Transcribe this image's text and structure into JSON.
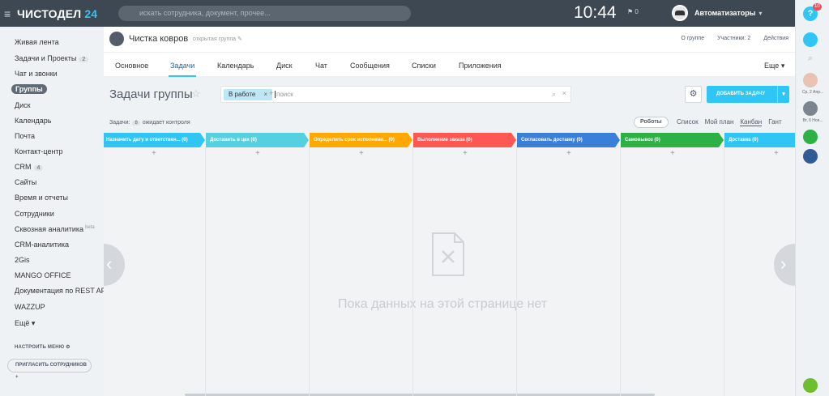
{
  "header": {
    "logo": "ЧИСТОДЕЛ",
    "logo_num": "24",
    "search_placeholder": "искать сотрудника, документ, прочее...",
    "clock": "10:44",
    "flag_count": "0",
    "user_name": "Автоматизаторы"
  },
  "rightbar": {
    "help": "?",
    "badge": "10",
    "chat1_label": "Ср, 2 Апр...",
    "chat2_label": "Вт, 6 Ноя..."
  },
  "sidebar": {
    "items": [
      {
        "label": "Живая лента"
      },
      {
        "label": "Задачи и Проекты",
        "count": "2"
      },
      {
        "label": "Чат и звонки"
      },
      {
        "label": "Группы"
      },
      {
        "label": "Диск"
      },
      {
        "label": "Календарь"
      },
      {
        "label": "Почта"
      },
      {
        "label": "Контакт-центр"
      },
      {
        "label": "CRM",
        "count": "4"
      },
      {
        "label": "Сайты"
      },
      {
        "label": "Время и отчеты"
      },
      {
        "label": "Сотрудники"
      },
      {
        "label": "Сквозная аналитика",
        "sup": "beta"
      },
      {
        "label": "CRM-аналитика"
      },
      {
        "label": "2Gis"
      },
      {
        "label": "MANGO OFFICE"
      },
      {
        "label": "Документация по REST API"
      },
      {
        "label": "WAZZUP"
      },
      {
        "label": "Ещё"
      }
    ],
    "configure_label": "НАСТРОИТЬ МЕНЮ",
    "invite_label": "ПРИГЛАСИТЬ СОТРУДНИКОВ"
  },
  "group": {
    "title": "Чистка ковров",
    "type": "открытая группа",
    "links": [
      "О группе",
      "Участники: 2",
      "Действия"
    ]
  },
  "tabs": [
    "Основное",
    "Задачи",
    "Календарь",
    "Диск",
    "Чат",
    "Сообщения",
    "Списки",
    "Приложения"
  ],
  "tabs_more": "Еще",
  "page": {
    "title": "Задачи группы",
    "filter_chip": "В работе",
    "filter_placeholder": "поиск",
    "add_button": "ДОБАВИТЬ ЗАДАЧУ"
  },
  "subbar": {
    "tasks_label": "Задачи:",
    "tasks_count": "8",
    "control_label": "ожидает контроля",
    "robots": "Роботы",
    "views": [
      "Список",
      "Мой план",
      "Канбан",
      "Гант"
    ]
  },
  "stages": [
    {
      "label": "Назначить дату и ответствен...",
      "count": "(0)",
      "color": "#2fc6f6"
    },
    {
      "label": "Доставить в цех",
      "count": "(0)",
      "color": "#55d0e0"
    },
    {
      "label": "Определить срок исполнени...",
      "count": "(0)",
      "color": "#ffa900"
    },
    {
      "label": "Выполнение заказа",
      "count": "(0)",
      "color": "#ff5752"
    },
    {
      "label": "Согласовать доставку",
      "count": "(0)",
      "color": "#3a80d9"
    },
    {
      "label": "Самовывоз",
      "count": "(0)",
      "color": "#2eb144"
    },
    {
      "label": "Доставка",
      "count": "(0)",
      "color": "#2fc6f6"
    }
  ],
  "empty_text": "Пока данных на этой странице нет"
}
